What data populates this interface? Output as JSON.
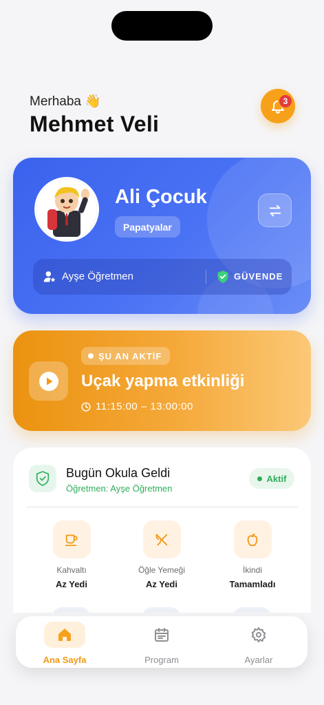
{
  "greeting": {
    "hello": "Merhaba 👋",
    "name": "Mehmet Veli"
  },
  "notifications": {
    "count": "3"
  },
  "child": {
    "name": "Ali Çocuk",
    "class": "Papatyalar",
    "teacher": "Ayşe Öğretmen",
    "safety_status": "GÜVENDE"
  },
  "activity": {
    "status": "ŞU AN AKTİF",
    "title": "Uçak yapma etkinliği",
    "time": "11:15:00 – 13:00:00"
  },
  "attendance": {
    "title": "Bugün Okula Geldi",
    "teacher": "Öğretmen: Ayşe Öğretmen",
    "status": "Aktif"
  },
  "meals": [
    {
      "label": "Kahvaltı",
      "value": "Az Yedi",
      "icon": "coffee-icon"
    },
    {
      "label": "Öğle Yemeği",
      "value": "Az Yedi",
      "icon": "utensils-icon"
    },
    {
      "label": "İkindi",
      "value": "Tamamladı",
      "icon": "apple-icon"
    }
  ],
  "tabs": [
    {
      "label": "Ana Sayfa",
      "icon": "home-icon",
      "active": true
    },
    {
      "label": "Program",
      "icon": "calendar-icon",
      "active": false
    },
    {
      "label": "Ayarlar",
      "icon": "gear-icon",
      "active": false
    }
  ],
  "colors": {
    "primary_blue": "#3a63ee",
    "accent_orange": "#f29a16",
    "success_green": "#2fae5a",
    "alert_red": "#e23b3b"
  }
}
